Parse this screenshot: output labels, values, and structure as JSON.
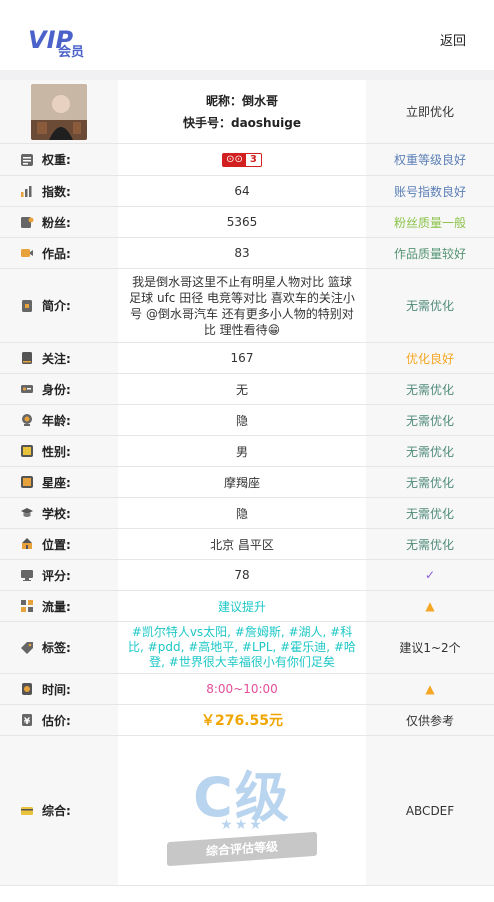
{
  "header": {
    "logo_text": "VIP会员",
    "back_label": "返回"
  },
  "profile": {
    "nickname_label": "昵称：倒水哥",
    "kuaishou_label": "快手号：daoshuige",
    "action": "立即优化"
  },
  "rows": [
    {
      "key": "weight",
      "label": "权重:",
      "value": "",
      "badge_left": "⊙⊙",
      "badge_right": "3",
      "status": "权重等级良好",
      "status_color": "#5b7fb6"
    },
    {
      "key": "index",
      "label": "指数:",
      "value": "64",
      "status": "账号指数良好",
      "status_color": "#5b7fb6"
    },
    {
      "key": "fans",
      "label": "粉丝:",
      "value": "5365",
      "status": "粉丝质量一般",
      "status_color": "#8bc34a"
    },
    {
      "key": "works",
      "label": "作品:",
      "value": "83",
      "status": "作品质量较好",
      "status_color": "#569474"
    },
    {
      "key": "intro",
      "label": "简介:",
      "value": "我是倒水哥这里不止有明星人物对比 篮球 足球 ufc 田径 电竞等对比 喜欢车的关注小号 @倒水哥汽车 还有更多小人物的特别对比 理性看待😁",
      "status": "无需优化",
      "status_color": "#4f8b7a"
    },
    {
      "key": "follow",
      "label": "关注:",
      "value": "167",
      "status": "优化良好",
      "status_color": "#f5a623"
    },
    {
      "key": "identity",
      "label": "身份:",
      "value": "无",
      "status": "无需优化",
      "status_color": "#4f8b7a"
    },
    {
      "key": "age",
      "label": "年龄:",
      "value": "隐",
      "status": "无需优化",
      "status_color": "#4f8b7a"
    },
    {
      "key": "gender",
      "label": "性别:",
      "value": "男",
      "status": "无需优化",
      "status_color": "#4f8b7a"
    },
    {
      "key": "zodiac",
      "label": "星座:",
      "value": "摩羯座",
      "status": "无需优化",
      "status_color": "#4f8b7a"
    },
    {
      "key": "school",
      "label": "学校:",
      "value": "隐",
      "status": "无需优化",
      "status_color": "#4f8b7a"
    },
    {
      "key": "location",
      "label": "位置:",
      "value": "北京 昌平区",
      "status": "无需优化",
      "status_color": "#4f8b7a"
    },
    {
      "key": "score",
      "label": "评分:",
      "value": "78",
      "status": "✓",
      "status_color": "#8c5bd4"
    },
    {
      "key": "traffic",
      "label": "流量:",
      "value": "建议提升",
      "value_color": "#1ec7c7",
      "status": "▲",
      "status_color": "#f5a623"
    },
    {
      "key": "tags",
      "label": "标签:",
      "value": "#凯尔特人vs太阳, #詹姆斯, #湖人, #科比, #pdd, #高地平, #LPL, #霍乐迪, #哈登, #世界很大幸福很小有你们足矣",
      "value_color": "#1ec7c7",
      "status": "建议1~2个",
      "status_color": "#333333"
    },
    {
      "key": "time",
      "label": "时间:",
      "value": "8:00~10:00",
      "value_color": "#e24f9a",
      "status": "▲",
      "status_color": "#f5a623"
    },
    {
      "key": "price",
      "label": "估价:",
      "value": "￥276.55元",
      "value_color": "#f0a500",
      "status": "仅供参考",
      "status_color": "#333333"
    },
    {
      "key": "overall",
      "label": "综合:",
      "grade": "C级",
      "grade_caption": "综合评估等级",
      "status": "ABCDEF",
      "status_color": "#333333"
    }
  ]
}
